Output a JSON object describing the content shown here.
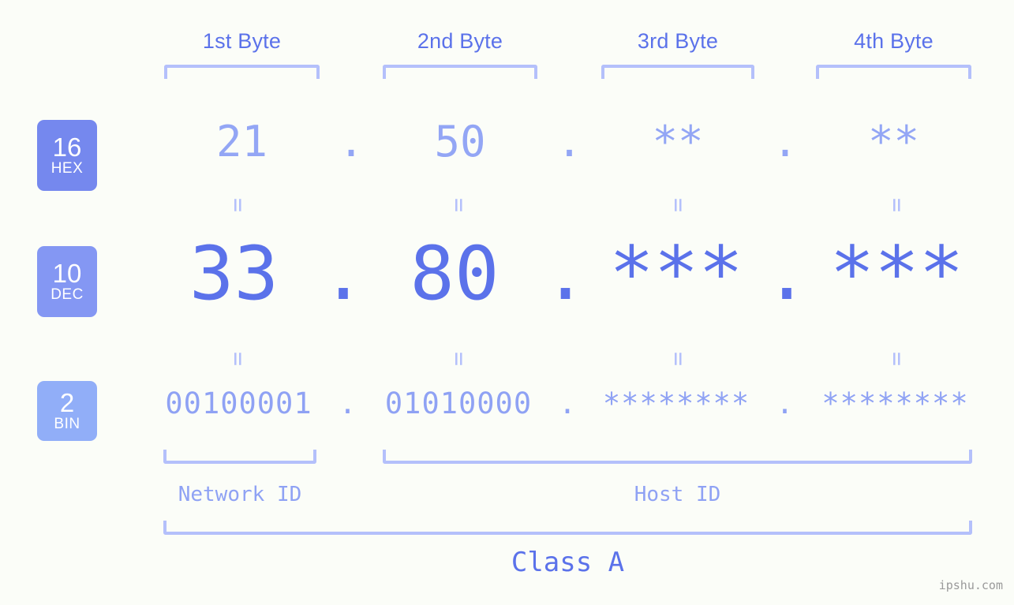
{
  "background_color": "#fbfdf8",
  "accent_colors": {
    "strong_blue": "#5b72ea",
    "mid_blue": "#8fa2f4",
    "light_blue": "#b4c0fb",
    "badge_hex": "#7588ee",
    "badge_dec": "#8497f3",
    "badge_bin": "#91aef8",
    "watermark_gray": "#9a9a9a"
  },
  "headers": [
    {
      "label": "1st Byte"
    },
    {
      "label": "2nd Byte"
    },
    {
      "label": "3rd Byte"
    },
    {
      "label": "4th Byte"
    }
  ],
  "bases": [
    {
      "number": "16",
      "name": "HEX"
    },
    {
      "number": "10",
      "name": "DEC"
    },
    {
      "number": "2",
      "name": "BIN"
    }
  ],
  "rows": {
    "hex": {
      "base_number": "16",
      "base_name": "HEX",
      "values": [
        "21",
        "50",
        "**",
        "**"
      ],
      "separator": "."
    },
    "dec": {
      "base_number": "10",
      "base_name": "DEC",
      "values": [
        "33",
        "80",
        "***",
        "***"
      ],
      "separator": "."
    },
    "bin": {
      "base_number": "2",
      "base_name": "BIN",
      "values": [
        "00100001",
        "01010000",
        "********",
        "********"
      ],
      "separator": "."
    }
  },
  "equality_marks": {
    "glyph": "=",
    "count_per_row": 4
  },
  "sections": {
    "network_id": "Network ID",
    "host_id": "Host ID",
    "class": "Class A"
  },
  "watermark": "ipshu.com"
}
